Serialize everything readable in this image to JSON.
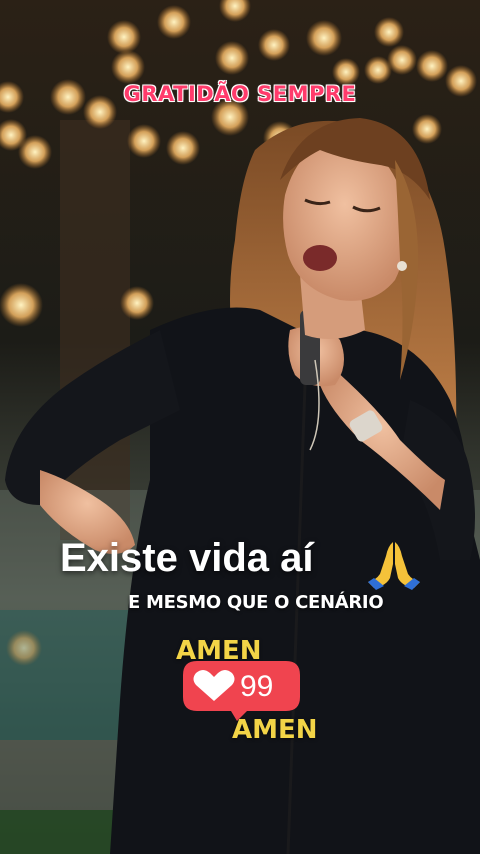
{
  "overlay": {
    "header": "GRATIDÃO SEMPRE",
    "caption_main": "Existe vida aí",
    "caption_sub": "E MESMO QUE O CENÁRIO",
    "amen_top": "AMEN",
    "amen_bottom": "AMEN",
    "like_count": "99"
  },
  "icons": {
    "pray": "praying-hands-icon",
    "heart": "heart-icon"
  },
  "colors": {
    "header_text": "#ff3b6b",
    "amen_text": "#f3d447",
    "like_bubble": "#f0444f",
    "caption_text": "#ffffff"
  }
}
